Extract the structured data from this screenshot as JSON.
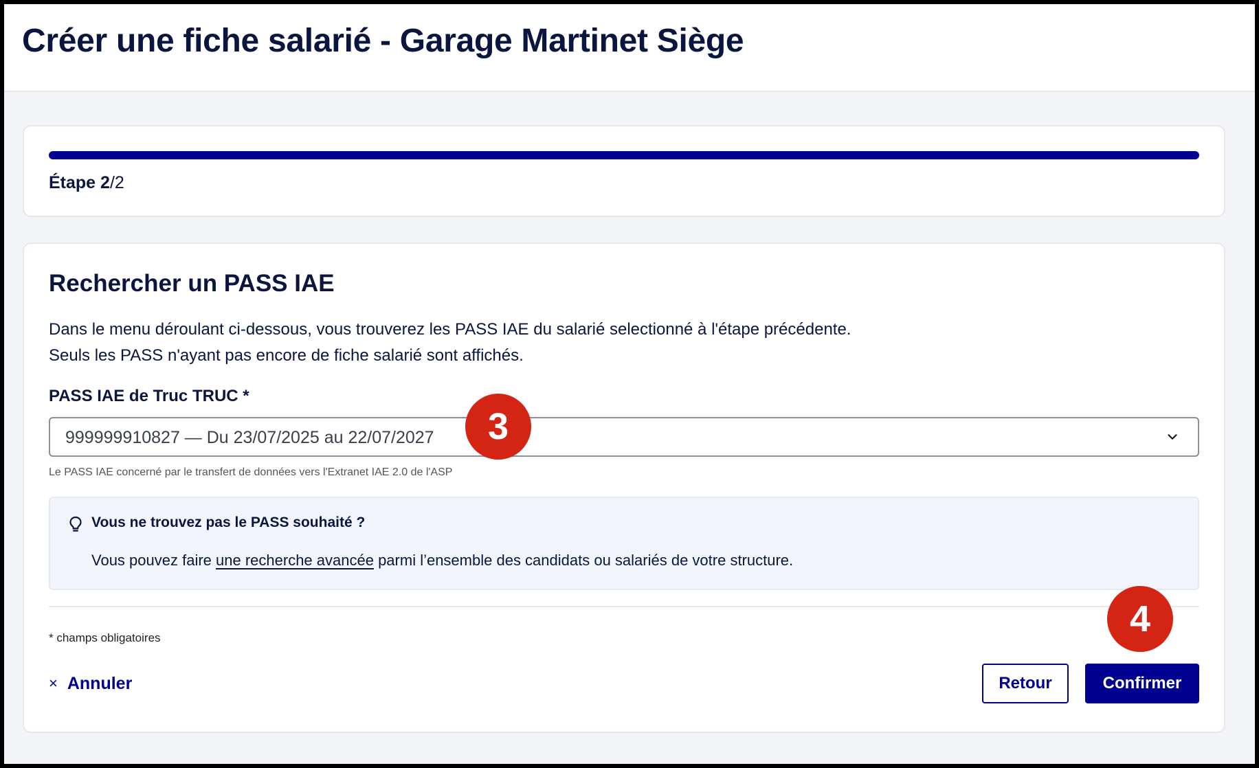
{
  "header": {
    "title": "Créer une fiche salarié - Garage Martinet Siège"
  },
  "progress": {
    "value": 1.0,
    "step_word": "Étape",
    "step_current": "2",
    "step_rest": "/2"
  },
  "section": {
    "title": "Rechercher un PASS IAE",
    "desc_line1": "Dans le menu déroulant ci-dessous, vous trouverez les PASS IAE du salarié selectionné à l'étape précédente.",
    "desc_line2": "Seuls les PASS n'ayant pas encore de fiche salarié sont affichés."
  },
  "field": {
    "label": "PASS IAE de Truc TRUC *",
    "value": "999999910827 — Du 23/07/2025 au 22/07/2027",
    "helper": "Le PASS IAE concerné par le transfert de données vers l'Extranet IAE 2.0 de l'ASP"
  },
  "info": {
    "title": "Vous ne trouvez pas le PASS souhaité ?",
    "text_before": "Vous pouvez faire ",
    "link": "une recherche avancée",
    "text_after": " parmi l’ensemble des candidats ou salariés de votre structure."
  },
  "form": {
    "required_note": "* champs obligatoires"
  },
  "actions": {
    "cancel_icon": "×",
    "cancel": "Annuler",
    "back": "Retour",
    "confirm": "Confirmer"
  },
  "annotations": {
    "marker_3": "3",
    "marker_4": "4"
  },
  "colors": {
    "primary": "#000091",
    "marker": "#d42414",
    "text": "#0a1640"
  }
}
